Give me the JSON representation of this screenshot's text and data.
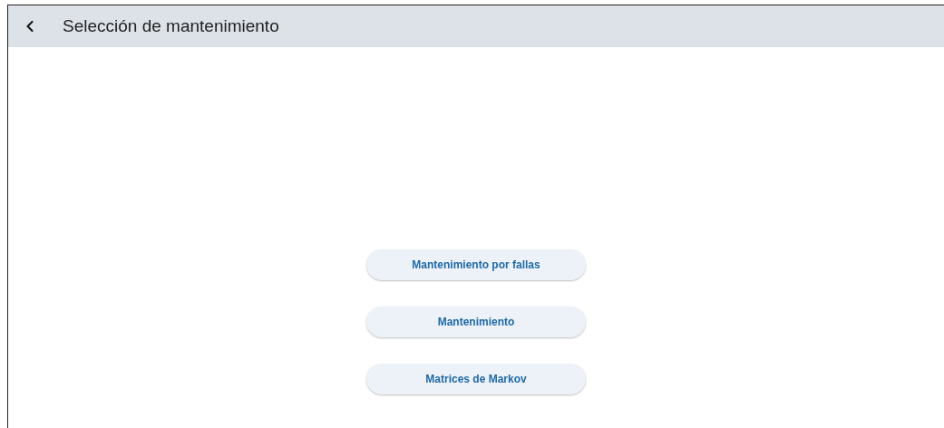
{
  "header": {
    "title": "Selección de mantenimiento"
  },
  "buttons": [
    {
      "label": "Mantenimiento por fallas"
    },
    {
      "label": "Mantenimiento"
    },
    {
      "label": "Matrices de Markov"
    }
  ]
}
